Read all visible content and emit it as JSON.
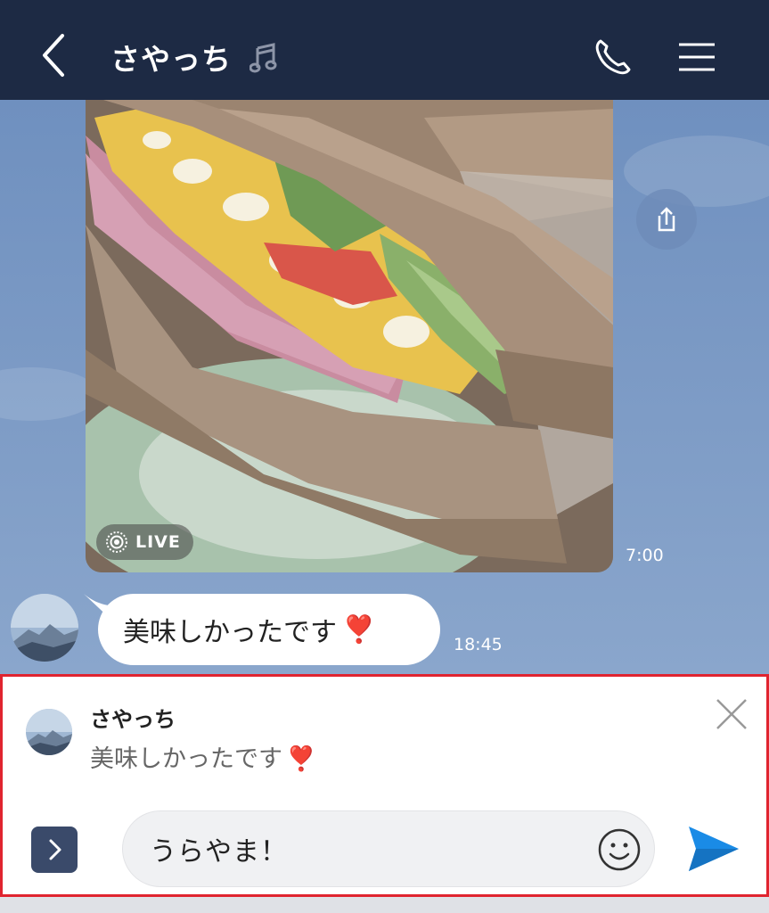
{
  "header": {
    "title": "さやっち"
  },
  "messages": [
    {
      "type": "photo",
      "badge": "LIVE",
      "time": "7:00"
    },
    {
      "type": "text",
      "text": "美味しかったです",
      "emoji": "❣️",
      "time": "18:45"
    }
  ],
  "reply": {
    "name": "さやっち",
    "text": "美味しかったです",
    "emoji": "❣️"
  },
  "composer": {
    "input_value": "うらやま！"
  },
  "colors": {
    "header_bg": "#1d2a44",
    "chat_bg": "#7d9ac4",
    "highlight_border": "#e0242f",
    "send_blue": "#1a8be6"
  },
  "icons": [
    "back-chevron-icon",
    "music-note-icon",
    "phone-icon",
    "menu-icon",
    "share-icon",
    "live-icon",
    "close-icon",
    "expand-chevron-icon",
    "smiley-icon",
    "send-icon"
  ]
}
